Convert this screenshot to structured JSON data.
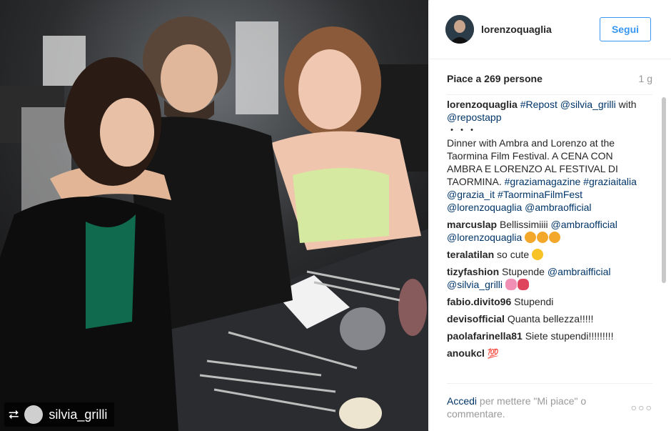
{
  "repost": {
    "username": "silvia_grilli",
    "icon": "repost-icon"
  },
  "header": {
    "username": "lorenzoquaglia",
    "follow_label": "Segui"
  },
  "post": {
    "likes_text": "Piace a 269 persone",
    "time_ago": "1 g"
  },
  "caption": {
    "user": "lorenzoquaglia",
    "parts": [
      "#Repost",
      "@silvia_grilli",
      "with",
      "@repostapp",
      "・・・",
      "Dinner with Ambra and Lorenzo at the Taormina Film Festival. A CENA CON AMBRA E LORENZO AL FESTIVAL DI TAORMINA.",
      "#graziamagazine",
      "#graziaitalia",
      "@grazia_it",
      "#TaorminaFilmFest",
      "@lorenzoquaglia",
      "@ambraofficial"
    ]
  },
  "comments": [
    {
      "user": "marcuslap",
      "text": "Bellissimiiii",
      "mentions": [
        "@ambraofficial",
        "@lorenzoquaglia"
      ],
      "emoji": "kissing-face-emojis"
    },
    {
      "user": "teralatilan",
      "text": "so cute",
      "emoji": "smiling-face-emoji"
    },
    {
      "user": "tizyfashion",
      "text": "Stupende",
      "mentions": [
        "@ambraifficial",
        "@silvia_grilli"
      ],
      "emoji": "flower-emojis"
    },
    {
      "user": "fabio.divito96",
      "text": "Stupendi"
    },
    {
      "user": "devisofficial",
      "text": "Quanta bellezza!!!!!"
    },
    {
      "user": "paolafarinella81",
      "text": "Siete stupendi!!!!!!!!!"
    },
    {
      "user": "anoukcl",
      "text": "",
      "emoji": "hundred-points-emoji"
    }
  ],
  "emoji_text": {
    "hundred": "💯"
  },
  "footer": {
    "login_label": "Accedi",
    "login_rest": "per mettere \"Mi piace\" o commentare.",
    "more_label": "○○○"
  },
  "colors": {
    "link": "#003569",
    "follow": "#3897f0",
    "muted": "#999999"
  }
}
